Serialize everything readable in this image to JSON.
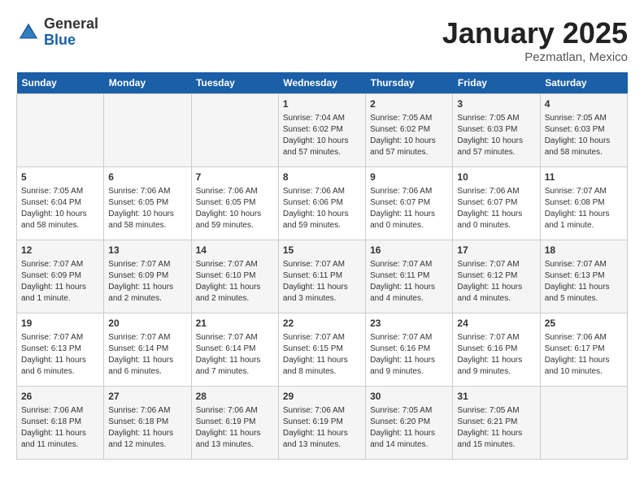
{
  "header": {
    "logo_general": "General",
    "logo_blue": "Blue",
    "month_title": "January 2025",
    "location": "Pezmatlan, Mexico"
  },
  "weekdays": [
    "Sunday",
    "Monday",
    "Tuesday",
    "Wednesday",
    "Thursday",
    "Friday",
    "Saturday"
  ],
  "weeks": [
    [
      {
        "day": "",
        "info": ""
      },
      {
        "day": "",
        "info": ""
      },
      {
        "day": "",
        "info": ""
      },
      {
        "day": "1",
        "info": "Sunrise: 7:04 AM\nSunset: 6:02 PM\nDaylight: 10 hours\nand 57 minutes."
      },
      {
        "day": "2",
        "info": "Sunrise: 7:05 AM\nSunset: 6:02 PM\nDaylight: 10 hours\nand 57 minutes."
      },
      {
        "day": "3",
        "info": "Sunrise: 7:05 AM\nSunset: 6:03 PM\nDaylight: 10 hours\nand 57 minutes."
      },
      {
        "day": "4",
        "info": "Sunrise: 7:05 AM\nSunset: 6:03 PM\nDaylight: 10 hours\nand 58 minutes."
      }
    ],
    [
      {
        "day": "5",
        "info": "Sunrise: 7:05 AM\nSunset: 6:04 PM\nDaylight: 10 hours\nand 58 minutes."
      },
      {
        "day": "6",
        "info": "Sunrise: 7:06 AM\nSunset: 6:05 PM\nDaylight: 10 hours\nand 58 minutes."
      },
      {
        "day": "7",
        "info": "Sunrise: 7:06 AM\nSunset: 6:05 PM\nDaylight: 10 hours\nand 59 minutes."
      },
      {
        "day": "8",
        "info": "Sunrise: 7:06 AM\nSunset: 6:06 PM\nDaylight: 10 hours\nand 59 minutes."
      },
      {
        "day": "9",
        "info": "Sunrise: 7:06 AM\nSunset: 6:07 PM\nDaylight: 11 hours\nand 0 minutes."
      },
      {
        "day": "10",
        "info": "Sunrise: 7:06 AM\nSunset: 6:07 PM\nDaylight: 11 hours\nand 0 minutes."
      },
      {
        "day": "11",
        "info": "Sunrise: 7:07 AM\nSunset: 6:08 PM\nDaylight: 11 hours\nand 1 minute."
      }
    ],
    [
      {
        "day": "12",
        "info": "Sunrise: 7:07 AM\nSunset: 6:09 PM\nDaylight: 11 hours\nand 1 minute."
      },
      {
        "day": "13",
        "info": "Sunrise: 7:07 AM\nSunset: 6:09 PM\nDaylight: 11 hours\nand 2 minutes."
      },
      {
        "day": "14",
        "info": "Sunrise: 7:07 AM\nSunset: 6:10 PM\nDaylight: 11 hours\nand 2 minutes."
      },
      {
        "day": "15",
        "info": "Sunrise: 7:07 AM\nSunset: 6:11 PM\nDaylight: 11 hours\nand 3 minutes."
      },
      {
        "day": "16",
        "info": "Sunrise: 7:07 AM\nSunset: 6:11 PM\nDaylight: 11 hours\nand 4 minutes."
      },
      {
        "day": "17",
        "info": "Sunrise: 7:07 AM\nSunset: 6:12 PM\nDaylight: 11 hours\nand 4 minutes."
      },
      {
        "day": "18",
        "info": "Sunrise: 7:07 AM\nSunset: 6:13 PM\nDaylight: 11 hours\nand 5 minutes."
      }
    ],
    [
      {
        "day": "19",
        "info": "Sunrise: 7:07 AM\nSunset: 6:13 PM\nDaylight: 11 hours\nand 6 minutes."
      },
      {
        "day": "20",
        "info": "Sunrise: 7:07 AM\nSunset: 6:14 PM\nDaylight: 11 hours\nand 6 minutes."
      },
      {
        "day": "21",
        "info": "Sunrise: 7:07 AM\nSunset: 6:14 PM\nDaylight: 11 hours\nand 7 minutes."
      },
      {
        "day": "22",
        "info": "Sunrise: 7:07 AM\nSunset: 6:15 PM\nDaylight: 11 hours\nand 8 minutes."
      },
      {
        "day": "23",
        "info": "Sunrise: 7:07 AM\nSunset: 6:16 PM\nDaylight: 11 hours\nand 9 minutes."
      },
      {
        "day": "24",
        "info": "Sunrise: 7:07 AM\nSunset: 6:16 PM\nDaylight: 11 hours\nand 9 minutes."
      },
      {
        "day": "25",
        "info": "Sunrise: 7:06 AM\nSunset: 6:17 PM\nDaylight: 11 hours\nand 10 minutes."
      }
    ],
    [
      {
        "day": "26",
        "info": "Sunrise: 7:06 AM\nSunset: 6:18 PM\nDaylight: 11 hours\nand 11 minutes."
      },
      {
        "day": "27",
        "info": "Sunrise: 7:06 AM\nSunset: 6:18 PM\nDaylight: 11 hours\nand 12 minutes."
      },
      {
        "day": "28",
        "info": "Sunrise: 7:06 AM\nSunset: 6:19 PM\nDaylight: 11 hours\nand 13 minutes."
      },
      {
        "day": "29",
        "info": "Sunrise: 7:06 AM\nSunset: 6:19 PM\nDaylight: 11 hours\nand 13 minutes."
      },
      {
        "day": "30",
        "info": "Sunrise: 7:05 AM\nSunset: 6:20 PM\nDaylight: 11 hours\nand 14 minutes."
      },
      {
        "day": "31",
        "info": "Sunrise: 7:05 AM\nSunset: 6:21 PM\nDaylight: 11 hours\nand 15 minutes."
      },
      {
        "day": "",
        "info": ""
      }
    ]
  ]
}
